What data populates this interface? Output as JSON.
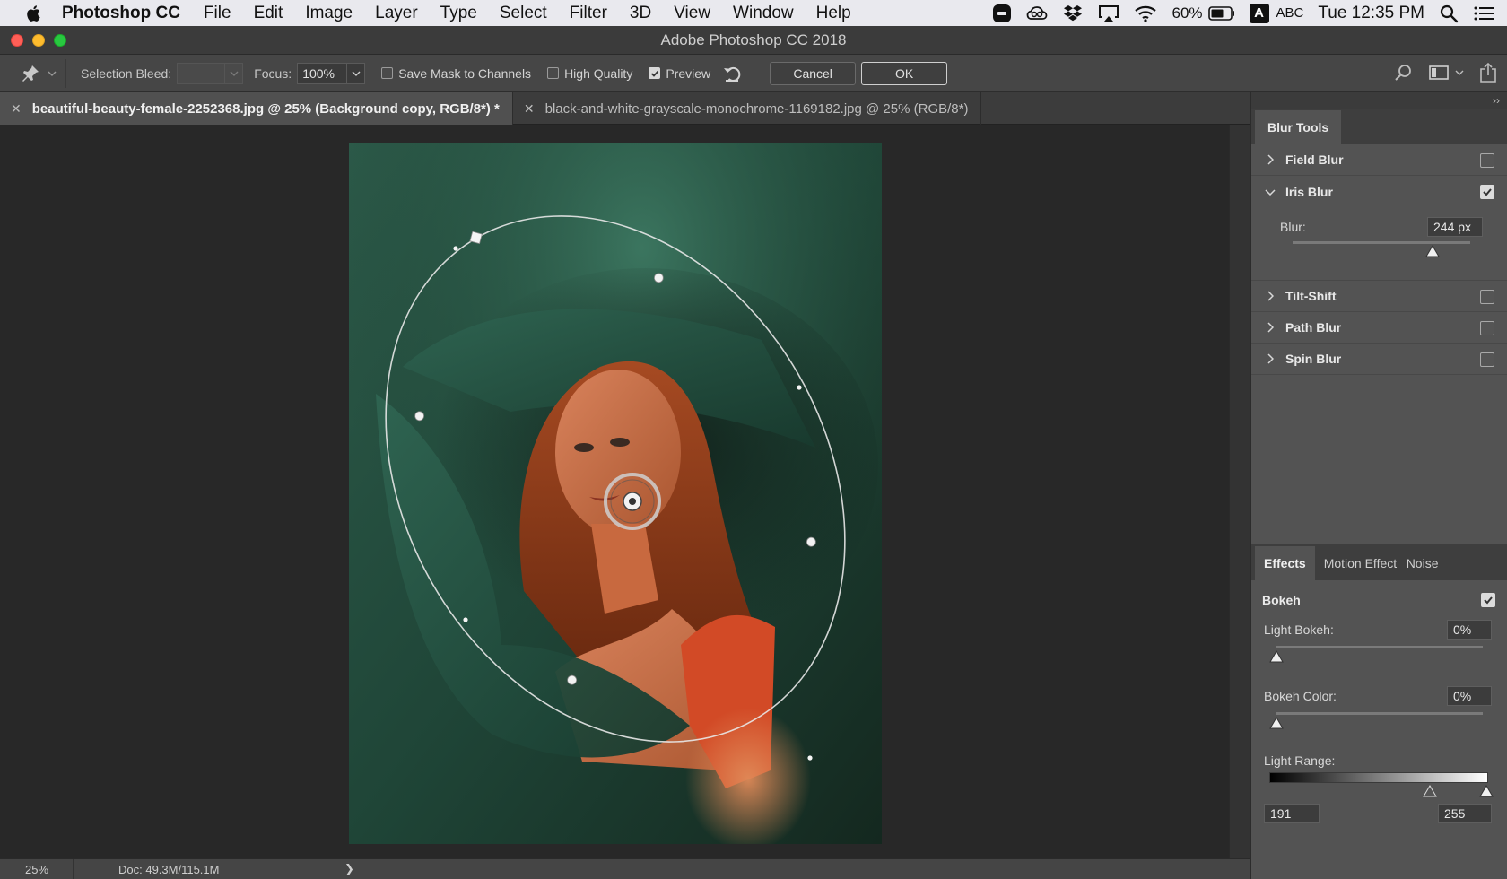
{
  "menubar": {
    "app_name": "Photoshop CC",
    "items": [
      "File",
      "Edit",
      "Image",
      "Layer",
      "Type",
      "Select",
      "Filter",
      "3D",
      "View",
      "Window",
      "Help"
    ],
    "battery": "60%",
    "input_badge": "A",
    "input_source": "ABC",
    "clock": "Tue 12:35 PM"
  },
  "window": {
    "title": "Adobe Photoshop CC 2018"
  },
  "options": {
    "selection_bleed_label": "Selection Bleed:",
    "selection_bleed_value": "",
    "focus_label": "Focus:",
    "focus_value": "100%",
    "save_mask_label": "Save Mask to Channels",
    "save_mask_checked": false,
    "high_quality_label": "High Quality",
    "high_quality_checked": false,
    "preview_label": "Preview",
    "preview_checked": true,
    "cancel_label": "Cancel",
    "ok_label": "OK"
  },
  "tabs": [
    {
      "label": "beautiful-beauty-female-2252368.jpg @ 25% (Background copy, RGB/8*) *",
      "active": true
    },
    {
      "label": "black-and-white-grayscale-monochrome-1169182.jpg @ 25% (RGB/8*)",
      "active": false
    }
  ],
  "status": {
    "zoom": "25%",
    "doc": "Doc: 49.3M/115.1M"
  },
  "blur_tools": {
    "panel_title": "Blur Tools",
    "field_blur": {
      "label": "Field Blur",
      "checked": false
    },
    "iris_blur": {
      "label": "Iris Blur",
      "checked": true,
      "blur_label": "Blur:",
      "blur_value": "244 px",
      "blur_fraction": 0.79
    },
    "tilt_shift": {
      "label": "Tilt-Shift",
      "checked": false
    },
    "path_blur": {
      "label": "Path Blur",
      "checked": false
    },
    "spin_blur": {
      "label": "Spin Blur",
      "checked": false
    }
  },
  "effects": {
    "tabs": [
      "Effects",
      "Motion Effect",
      "Noise"
    ],
    "bokeh_label": "Bokeh",
    "bokeh_checked": true,
    "light_bokeh_label": "Light Bokeh:",
    "light_bokeh_value": "0%",
    "bokeh_color_label": "Bokeh Color:",
    "bokeh_color_value": "0%",
    "light_range_label": "Light Range:",
    "light_range_min": "191",
    "light_range_max": "255"
  }
}
